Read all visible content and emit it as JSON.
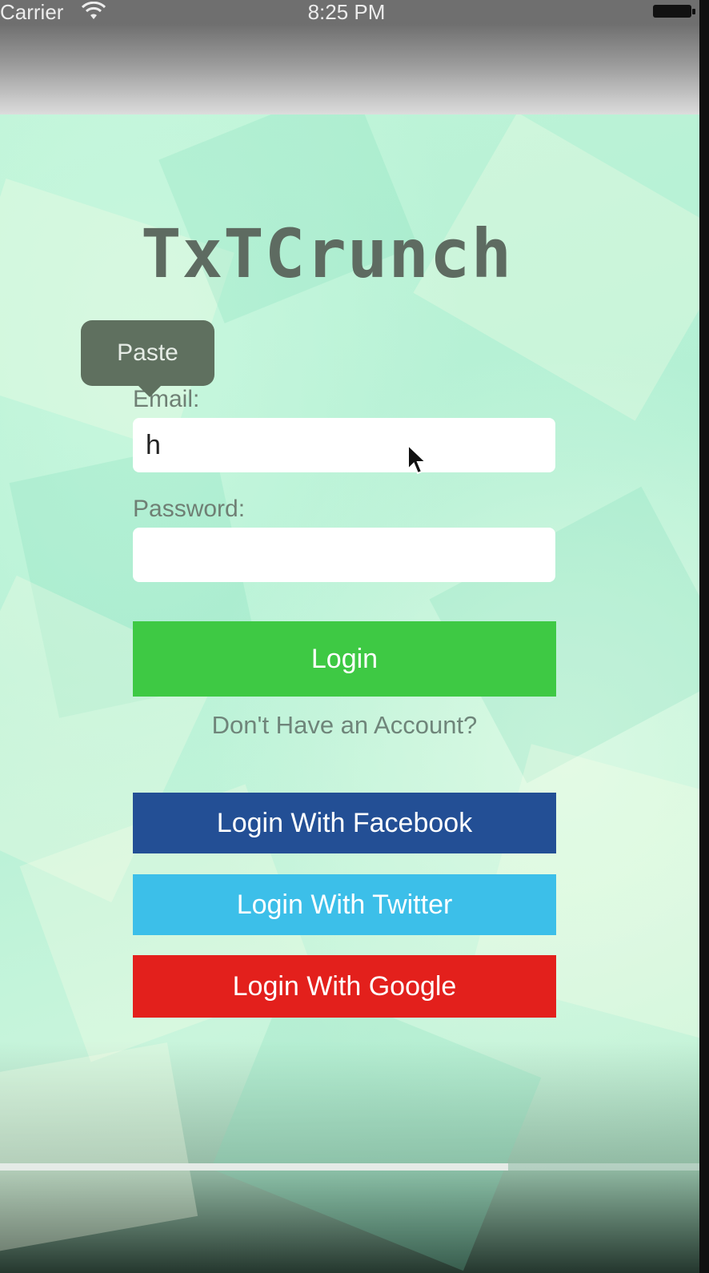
{
  "status_bar": {
    "carrier": "Carrier",
    "time": "8:25 PM"
  },
  "app": {
    "title": "TxTCrunch"
  },
  "context_menu": {
    "paste_label": "Paste"
  },
  "form": {
    "email_label": "Email:",
    "email_value": "h",
    "password_label": "Password:",
    "password_value": ""
  },
  "buttons": {
    "login": "Login",
    "no_account": "Don't Have an Account?",
    "facebook": "Login With Facebook",
    "twitter": "Login With Twitter",
    "google": "Login With Google"
  },
  "colors": {
    "login": "#3ec944",
    "facebook": "#234f95",
    "twitter": "#3cbfe9",
    "google": "#e3201c"
  },
  "video_progress": {
    "fraction": 0.727
  }
}
